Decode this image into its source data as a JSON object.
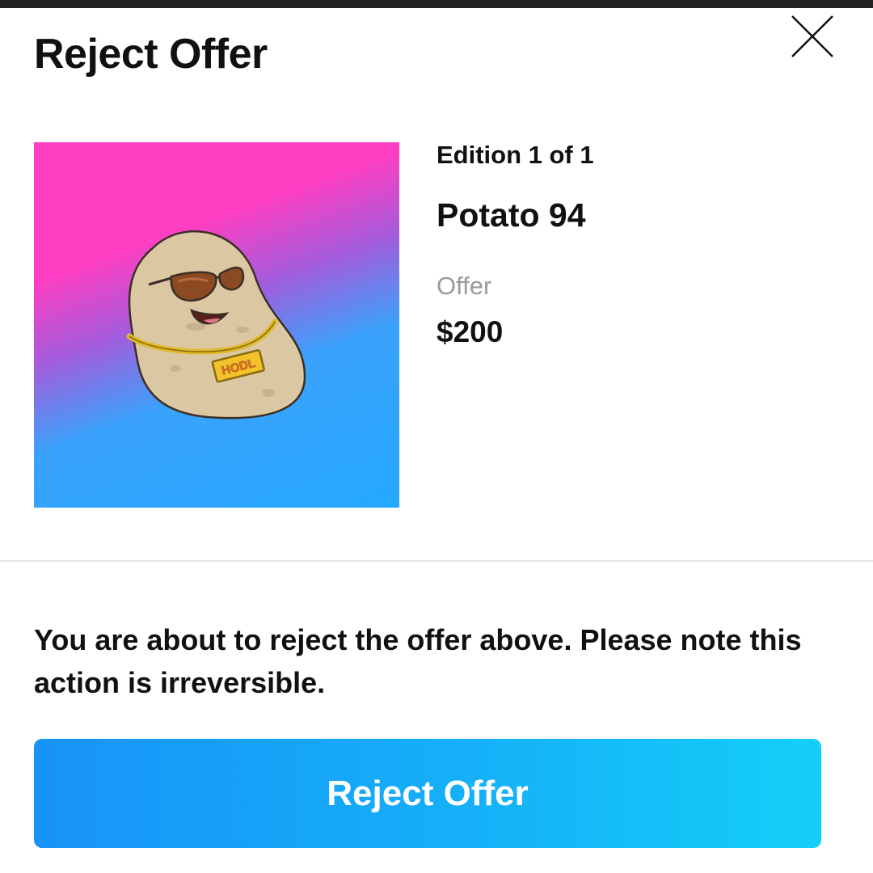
{
  "modal": {
    "title": "Reject Offer",
    "close_icon": "close-icon"
  },
  "item": {
    "edition": "Edition 1 of 1",
    "name": "Potato 94",
    "offer_label": "Offer",
    "offer_value": "$200",
    "artwork": {
      "chain_tag": "HODL",
      "background_colors": [
        "#ff3ec2",
        "#24a8ff"
      ]
    }
  },
  "notice": "You are about to reject the offer above. Please note this action is irreversible.",
  "actions": {
    "reject_label": "Reject Offer",
    "reject_gradient": [
      "#1893f8",
      "#14cff8"
    ]
  }
}
